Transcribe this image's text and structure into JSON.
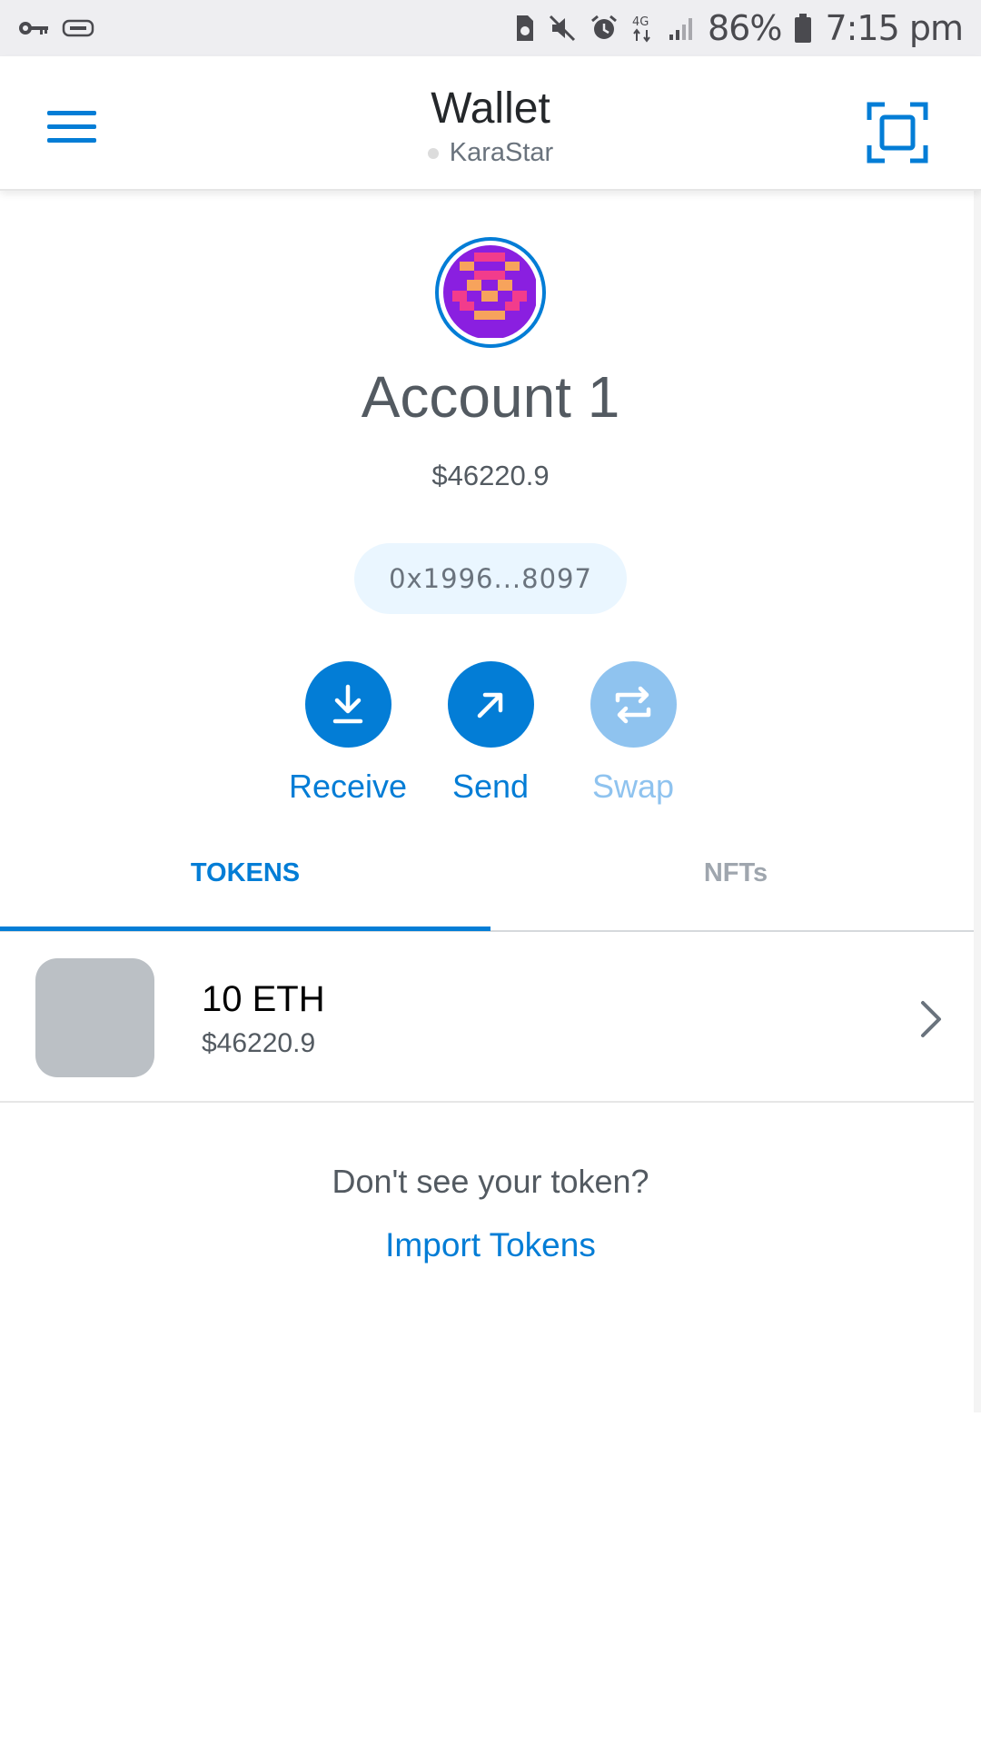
{
  "status_bar": {
    "battery_percent": "86%",
    "time": "7:15 pm",
    "network_type": "4G",
    "icons": [
      "key-icon",
      "usb-debug-icon",
      "sim-icon",
      "mute-icon",
      "alarm-icon",
      "network-4g-icon",
      "signal-icon",
      "battery-icon"
    ]
  },
  "header": {
    "title": "Wallet",
    "network_name": "KaraStar",
    "menu_icon": "hamburger-menu-icon",
    "scan_icon": "qr-scan-icon"
  },
  "account": {
    "name": "Account 1",
    "balance": "$46220.9",
    "address": "0x1996...8097"
  },
  "actions": [
    {
      "label": "Receive",
      "icon": "receive-arrow-icon",
      "enabled": true
    },
    {
      "label": "Send",
      "icon": "send-arrow-icon",
      "enabled": true
    },
    {
      "label": "Swap",
      "icon": "swap-icon",
      "enabled": false
    }
  ],
  "tabs": [
    {
      "label": "TOKENS",
      "active": true
    },
    {
      "label": "NFTs",
      "active": false
    }
  ],
  "tokens": [
    {
      "amount": "10 ETH",
      "fiat": "$46220.9"
    }
  ],
  "footer": {
    "missing_prompt": "Don't see your token?",
    "import_link": "Import Tokens"
  },
  "colors": {
    "accent": "#037dd6",
    "accent_disabled": "#8fc3ef",
    "address_pill_bg": "#eaf6ff",
    "token_placeholder": "#bbc0c5",
    "status_bar_bg": "#eeeef1"
  }
}
